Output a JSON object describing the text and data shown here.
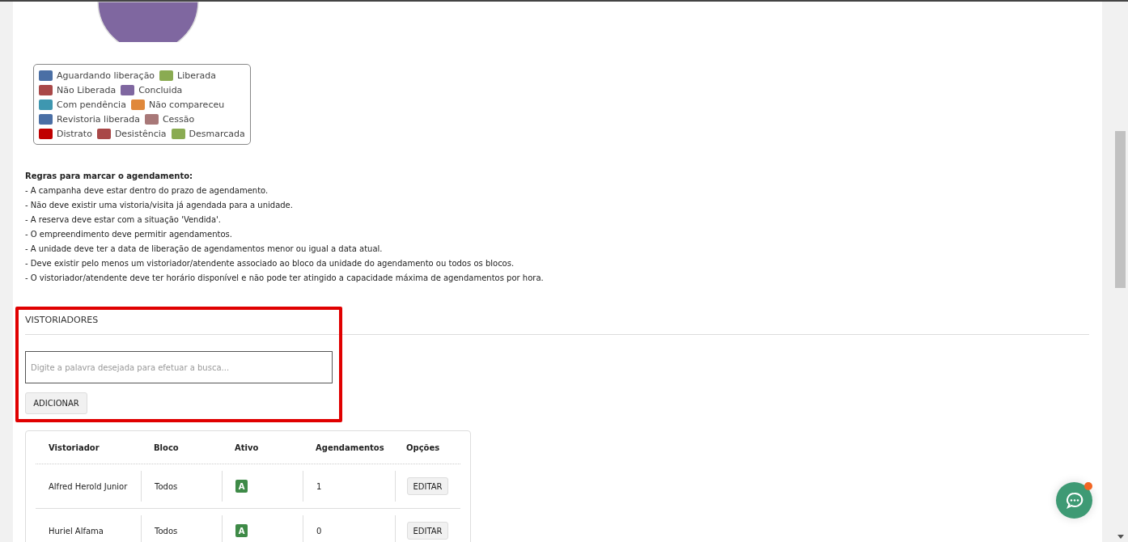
{
  "legend": {
    "rows": [
      [
        {
          "label": "Aguardando liberação",
          "color": "#4a6fa5"
        },
        {
          "label": "Liberada",
          "color": "#8aab52"
        }
      ],
      [
        {
          "label": "Não Liberada",
          "color": "#a94848"
        },
        {
          "label": "Concluida",
          "color": "#7f67a0"
        }
      ],
      [
        {
          "label": "Com pendência",
          "color": "#3e97b0"
        },
        {
          "label": "Não compareceu",
          "color": "#e0883b"
        }
      ],
      [
        {
          "label": "Revistoria liberada",
          "color": "#4a6fa5"
        },
        {
          "label": "Cessão",
          "color": "#a87878"
        }
      ],
      [
        {
          "label": "Distrato",
          "color": "#c00000"
        },
        {
          "label": "Desistência",
          "color": "#a94848"
        },
        {
          "label": "Desmarcada",
          "color": "#8aab52"
        }
      ]
    ]
  },
  "rules": {
    "title": "Regras para marcar o agendamento:",
    "items": [
      "- A campanha deve estar dentro do prazo de agendamento.",
      "- Não deve existir uma vistoria/visita já agendada para a unidade.",
      "- A reserva deve estar com a situação 'Vendida'.",
      "- O empreendimento deve permitir agendamentos.",
      "- A unidade deve ter a data de liberação de agendamentos menor ou igual a data atual.",
      "- Deve existir pelo menos um vistoriador/atendente associado ao bloco da unidade do agendamento ou todos os blocos.",
      "- O vistoriador/atendente deve ter horário disponível e não pode ter atingido a capacidade máxima de agendamentos por hora."
    ]
  },
  "section": {
    "title": "VISTORIADORES",
    "search": {
      "placeholder": "Digite a palavra desejada para efetuar a busca..."
    },
    "add_button": "ADICIONAR"
  },
  "table": {
    "columns": [
      "Vistoriador",
      "Bloco",
      "Ativo",
      "Agendamentos",
      "Opções"
    ],
    "rows": [
      {
        "name": "Alfred Herold Junior",
        "bloco": "Todos",
        "ativo": "A",
        "agendamentos": "1",
        "action": "EDITAR"
      },
      {
        "name": "Huriel Alfama",
        "bloco": "Todos",
        "ativo": "A",
        "agendamentos": "0",
        "action": "EDITAR"
      }
    ]
  },
  "chat": {
    "notification": true
  }
}
